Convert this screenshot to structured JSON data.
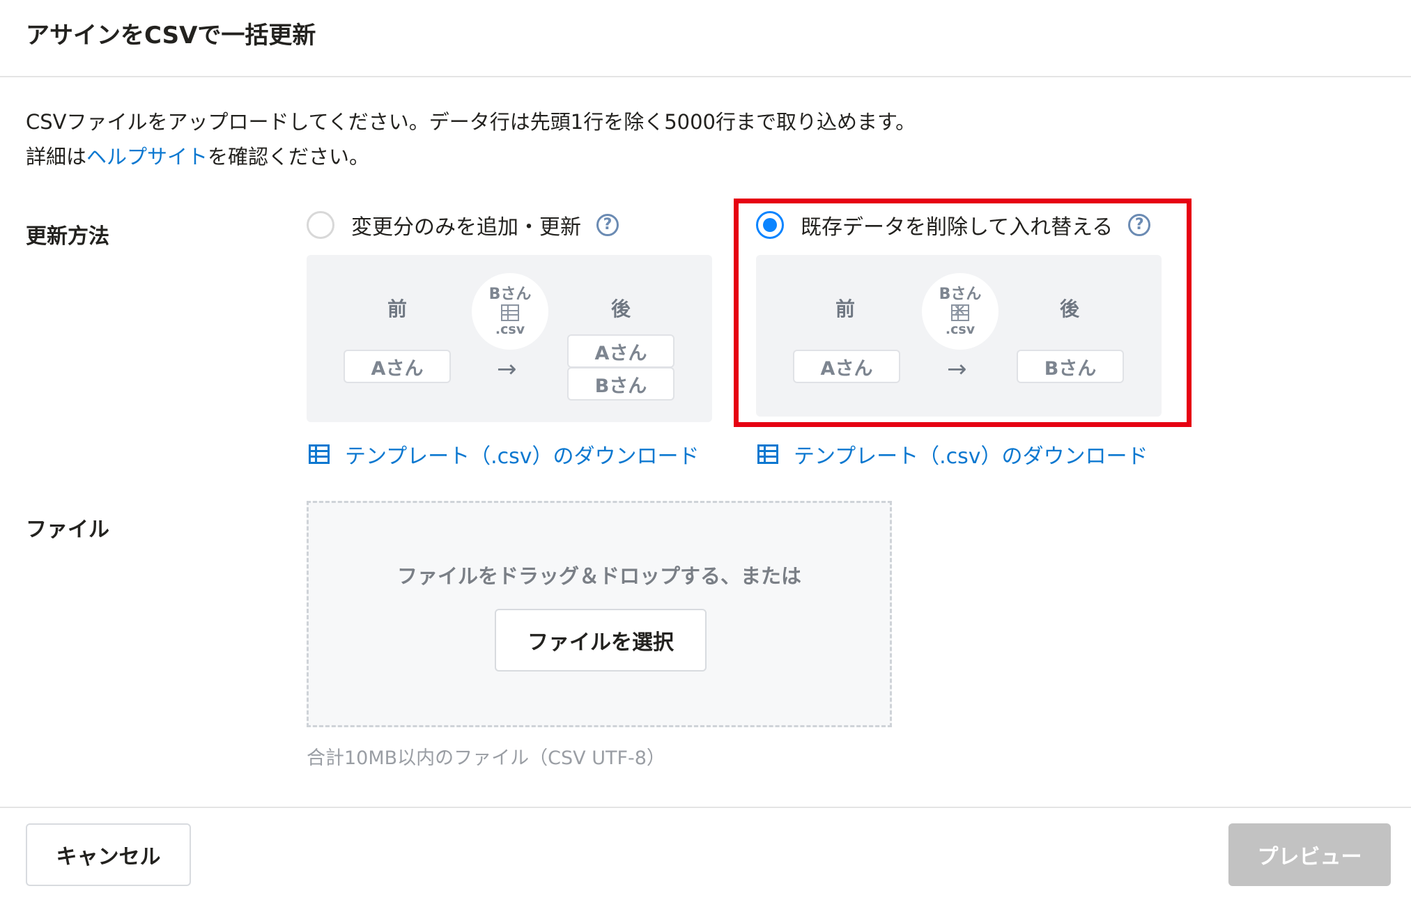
{
  "dialog": {
    "title": "アサインをCSVで一括更新"
  },
  "description": {
    "line1": "CSVファイルをアップロードしてください。データ行は先頭1行を除く5000行まで取り込めます。",
    "line2_before": "詳細は",
    "line2_link": "ヘルプサイト",
    "line2_after": "を確認ください。"
  },
  "update_method": {
    "label": "更新方法",
    "options": [
      {
        "label": "変更分のみを追加・更新",
        "selected": false,
        "help_icon": "question-circle-icon",
        "diagram": {
          "before_label": "前",
          "after_label": "後",
          "before_items": [
            "Aさん"
          ],
          "csv_name": "Bさん",
          "csv_ext": ".csv",
          "after_items": [
            "Aさん",
            "Bさん"
          ]
        },
        "template_link": "テンプレート（.csv）のダウンロード"
      },
      {
        "label": "既存データを削除して入れ替える",
        "selected": true,
        "help_icon": "question-circle-icon",
        "diagram": {
          "before_label": "前",
          "after_label": "後",
          "before_items": [
            "Aさん"
          ],
          "csv_name": "Bさん",
          "csv_ext": ".csv",
          "after_items": [
            "Bさん"
          ]
        },
        "template_link": "テンプレート（.csv）のダウンロード"
      }
    ]
  },
  "file": {
    "label": "ファイル",
    "drop_text": "ファイルをドラッグ＆ドロップする、または",
    "select_button": "ファイルを選択",
    "note": "合計10MB以内のファイル（CSV UTF-8）"
  },
  "footer": {
    "cancel_button": "キャンセル",
    "preview_button": "プレビュー"
  },
  "colors": {
    "accent": "#0a84ff",
    "link": "#0c78d0",
    "highlight": "#e60012",
    "disabled_button": "#c2c2c2"
  }
}
